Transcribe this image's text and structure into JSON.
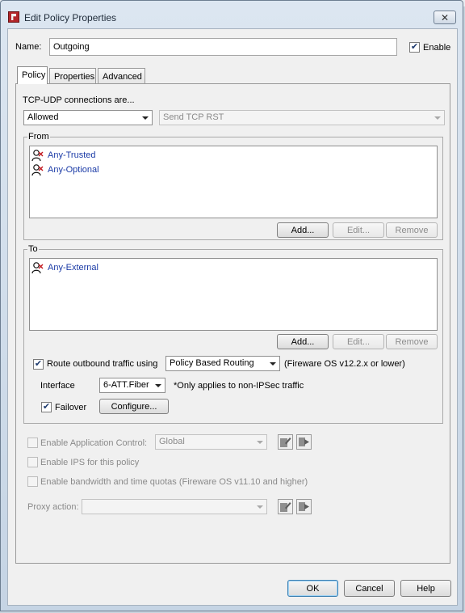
{
  "window": {
    "title": "Edit Policy Properties",
    "close_glyph": "✕"
  },
  "name_row": {
    "label": "Name:",
    "value": "Outgoing",
    "enable_label": "Enable",
    "enable_checked": true
  },
  "tabs": [
    {
      "label": "Policy",
      "active": true
    },
    {
      "label": "Properties",
      "active": false
    },
    {
      "label": "Advanced",
      "active": false
    }
  ],
  "connections": {
    "label": "TCP-UDP connections are...",
    "action": "Allowed",
    "rst_option": "Send TCP RST"
  },
  "from": {
    "title": "From",
    "items": [
      "Any-Trusted",
      "Any-Optional"
    ],
    "add_label": "Add...",
    "edit_label": "Edit...",
    "remove_label": "Remove"
  },
  "to": {
    "title": "To",
    "items": [
      "Any-External"
    ],
    "add_label": "Add...",
    "edit_label": "Edit...",
    "remove_label": "Remove",
    "route_label": "Route outbound traffic using",
    "route_value": "Policy Based Routing",
    "route_note": "(Fireware OS v12.2.x or lower)",
    "interface_label": "Interface",
    "interface_value": "6-ATT.Fiber",
    "interface_note": "*Only applies to non-IPSec traffic",
    "failover_label": "Failover",
    "configure_label": "Configure..."
  },
  "options": {
    "app_control_label": "Enable Application Control:",
    "app_control_value": "Global",
    "ips_label": "Enable IPS for this policy",
    "quota_label": "Enable bandwidth and time quotas (Fireware OS v11.10 and higher)",
    "proxy_label": "Proxy action:",
    "proxy_value": ""
  },
  "footer": {
    "ok": "OK",
    "cancel": "Cancel",
    "help": "Help"
  },
  "icons": {
    "alias": "user-alias-icon",
    "edit": "edit-icon",
    "clone": "clone-icon"
  }
}
